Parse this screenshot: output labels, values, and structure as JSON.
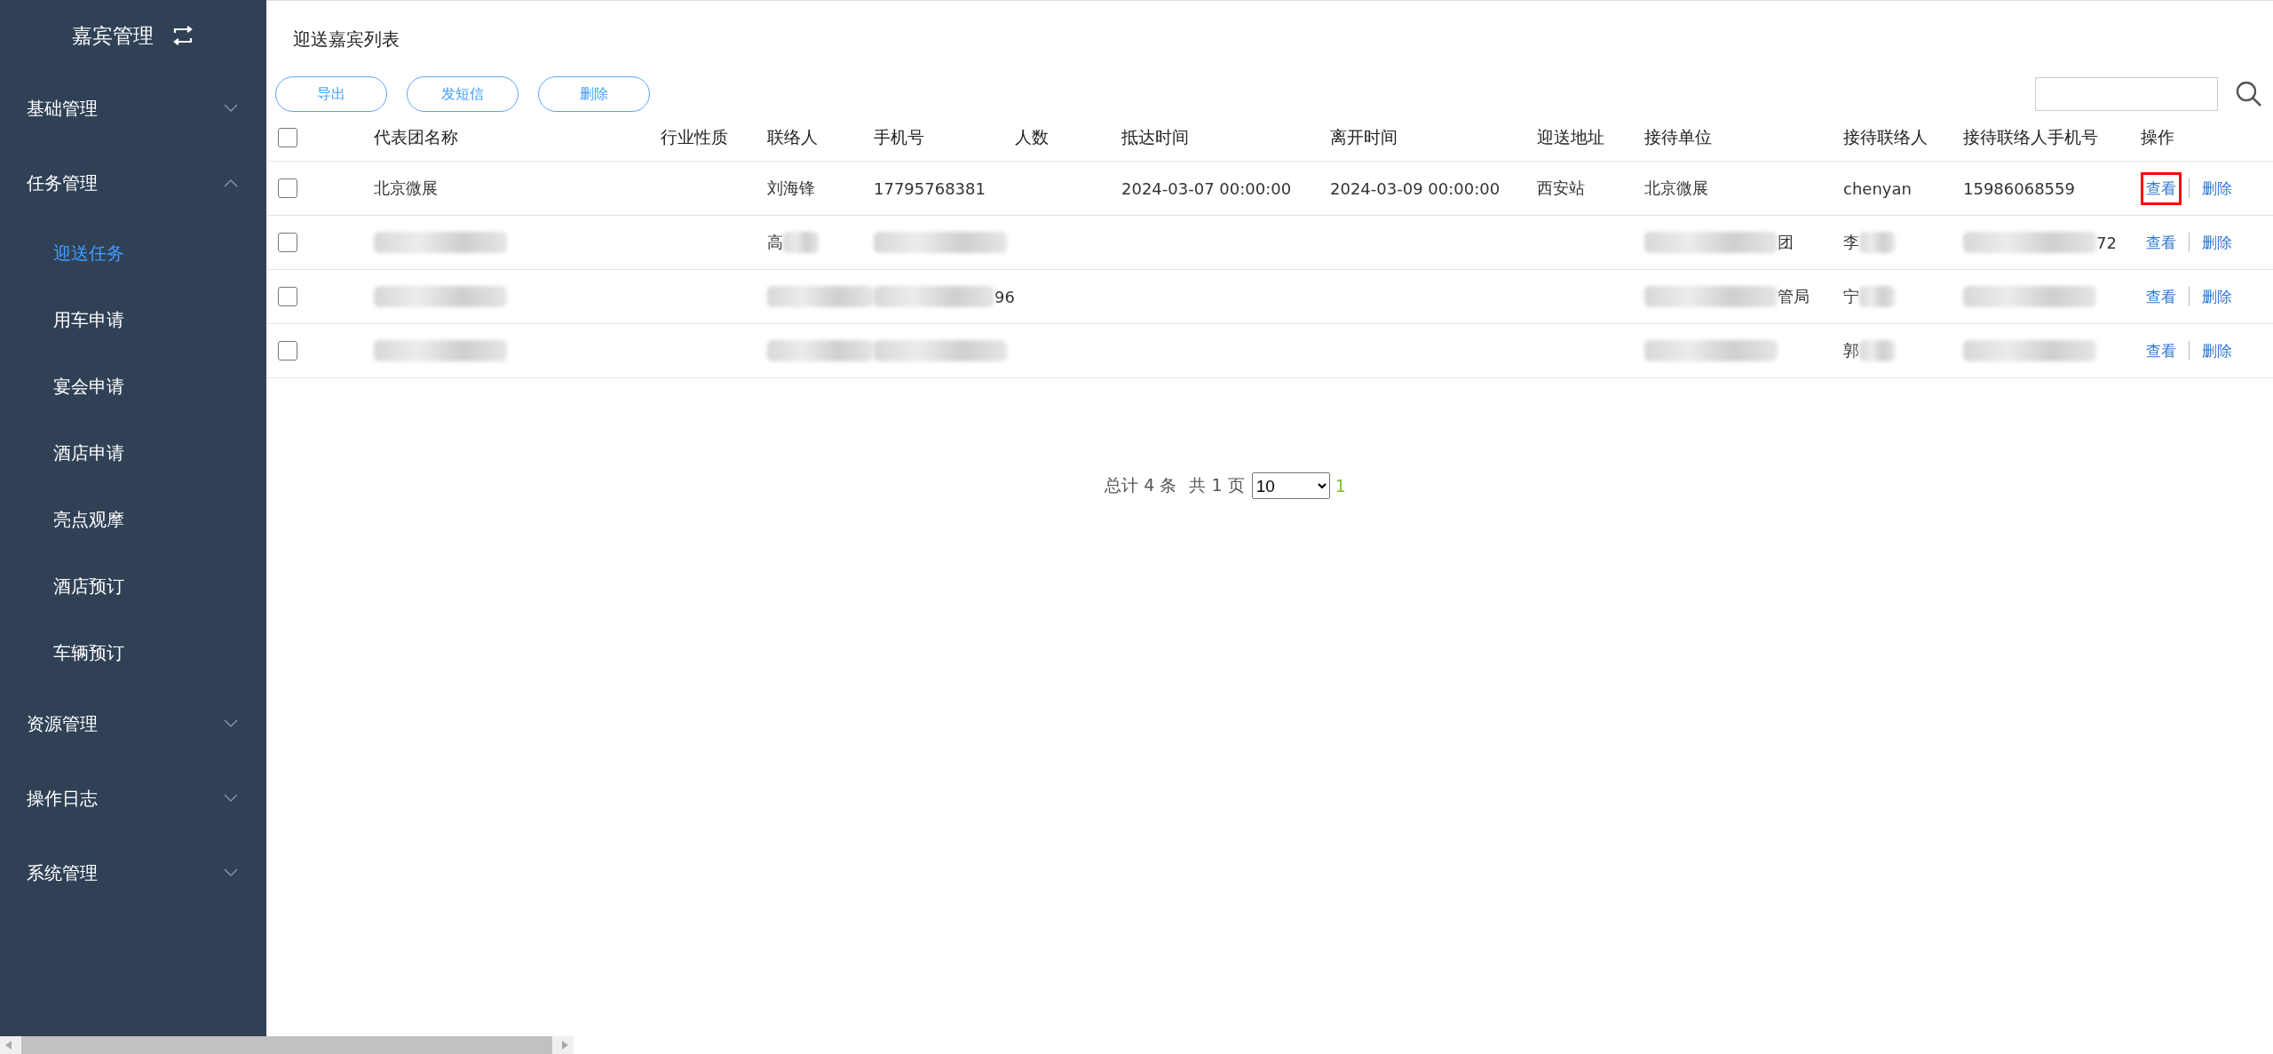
{
  "sidebar": {
    "title": "嘉宾管理",
    "items": [
      {
        "label": "基础管理",
        "expanded": false
      },
      {
        "label": "任务管理",
        "expanded": true,
        "children": [
          {
            "label": "迎送任务",
            "selected": true
          },
          {
            "label": "用车申请",
            "selected": false
          },
          {
            "label": "宴会申请",
            "selected": false
          },
          {
            "label": "酒店申请",
            "selected": false
          },
          {
            "label": "亮点观摩",
            "selected": false
          },
          {
            "label": "酒店预订",
            "selected": false
          },
          {
            "label": "车辆预订",
            "selected": false
          }
        ]
      },
      {
        "label": "资源管理",
        "expanded": false
      },
      {
        "label": "操作日志",
        "expanded": false
      },
      {
        "label": "系统管理",
        "expanded": false
      }
    ]
  },
  "page_title": "迎送嘉宾列表",
  "toolbar": {
    "buttons": [
      "导出",
      "发短信",
      "删除"
    ]
  },
  "table": {
    "all_checked": false,
    "columns": [
      "代表团名称",
      "行业性质",
      "联络人",
      "手机号",
      "人数",
      "抵达时间",
      "离开时间",
      "迎送地址",
      "接待单位",
      "接待联络人",
      "接待联络人手机号",
      "操作"
    ],
    "rows": [
      {
        "checked": false,
        "cells": [
          {
            "text": "北京微展"
          },
          {},
          {
            "text": "刘海锋"
          },
          {
            "text": "17795768381"
          },
          {},
          {
            "text": "2024-03-07 00:00:00"
          },
          {
            "text": "2024-03-09 00:00:00"
          },
          {
            "text": "西安站"
          },
          {
            "text": "北京微展"
          },
          {
            "text": "chenyan"
          },
          {
            "text": "15986068559"
          }
        ],
        "actions": [
          {
            "label": "查看",
            "highlighted": true
          },
          {
            "label": "删除",
            "highlighted": false
          }
        ]
      },
      {
        "checked": false,
        "cells": [
          {
            "redacted_prefix": true
          },
          {},
          {
            "text": "高",
            "redacted_suffix": true
          },
          {
            "redacted_prefix": true
          },
          {},
          {},
          {},
          {},
          {
            "text": "团",
            "redacted_prefix": true
          },
          {
            "text": "李",
            "redacted_suffix": true
          },
          {
            "text": "72",
            "redacted_prefix": true
          }
        ],
        "actions": [
          {
            "label": "查看",
            "highlighted": false
          },
          {
            "label": "删除",
            "highlighted": false
          }
        ]
      },
      {
        "checked": false,
        "cells": [
          {
            "redacted_prefix": true
          },
          {},
          {
            "redacted_prefix": true
          },
          {
            "text": "96",
            "redacted_prefix": true
          },
          {},
          {},
          {},
          {},
          {
            "text": "管局",
            "redacted_prefix": true
          },
          {
            "text": "宁",
            "redacted_suffix": true
          },
          {
            "redacted_prefix": true
          }
        ],
        "actions": [
          {
            "label": "查看",
            "highlighted": false
          },
          {
            "label": "删除",
            "highlighted": false
          }
        ]
      },
      {
        "checked": false,
        "cells": [
          {
            "redacted_prefix": true
          },
          {},
          {
            "redacted_prefix": true
          },
          {
            "redacted_prefix": true
          },
          {},
          {},
          {},
          {},
          {
            "redacted_prefix": true
          },
          {
            "text": "郭",
            "redacted_suffix": true
          },
          {
            "redacted_prefix": true
          }
        ],
        "actions": [
          {
            "label": "查看",
            "highlighted": false
          },
          {
            "label": "删除",
            "highlighted": false
          }
        ]
      }
    ]
  },
  "pagination": {
    "total": "总计 4 条",
    "pages": "共 1 页",
    "page_size": "10",
    "current": "1"
  }
}
